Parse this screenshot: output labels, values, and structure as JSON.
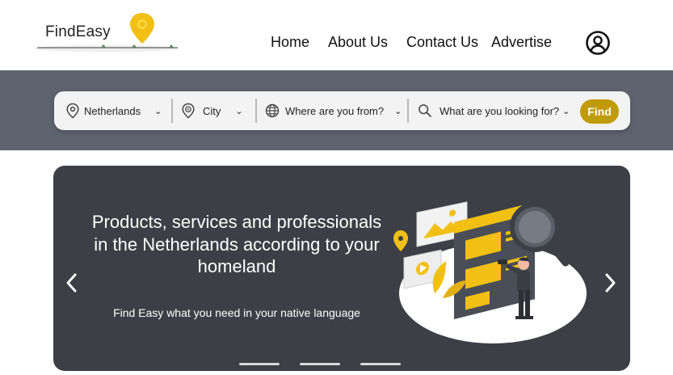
{
  "header": {
    "logo_text": "FindEasy",
    "nav": [
      "Home",
      "About Us",
      "Contact Us",
      "Advertise"
    ]
  },
  "search": {
    "country": "Netherlands",
    "city": "City",
    "origin": "Where are you from?",
    "query_placeholder": "What are you looking for?",
    "find_label": "Find",
    "accent_color": "#c19a07"
  },
  "hero": {
    "title": "Products, services and professionals in the Netherlands according to your homeland",
    "subtitle": "Find Easy what you need in your native language",
    "slides": 3,
    "active_slide": 1
  },
  "icons": {
    "user": "user-circle-icon",
    "location": "location-pin-icon",
    "city": "target-pin-icon",
    "globe": "globe-icon",
    "search": "search-icon",
    "prev": "chevron-left-icon",
    "next": "chevron-right-icon"
  }
}
